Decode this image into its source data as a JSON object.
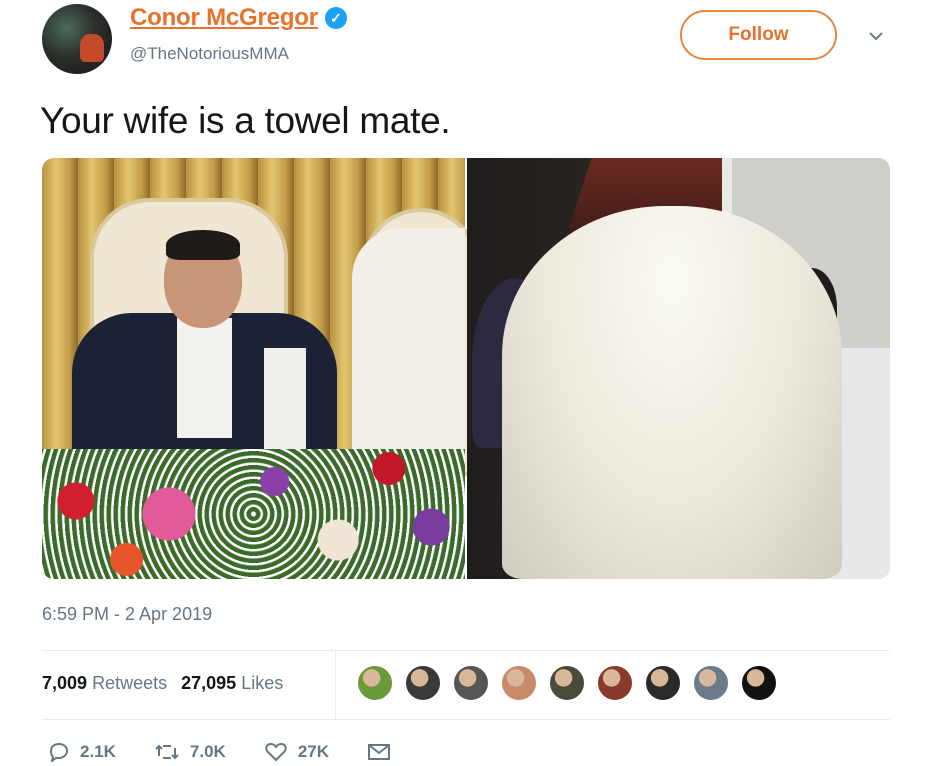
{
  "author": {
    "display_name": "Conor McGregor",
    "handle": "@TheNotoriousMMA",
    "verified": true
  },
  "follow_button": {
    "label": "Follow"
  },
  "tweet": {
    "text": "Your wife is a towel mate.",
    "timestamp": "6:59 PM - 2 Apr 2019"
  },
  "stats": {
    "retweets_count": "7,009",
    "retweets_label": "Retweets",
    "likes_count": "27,095",
    "likes_label": "Likes"
  },
  "liker_avatar_colors": [
    "#6a9a3a",
    "#3a3a3a",
    "#555555",
    "#c98a6a",
    "#4a4a3a",
    "#8a3a2a",
    "#2a2a2a",
    "#6a7a8a",
    "#111111"
  ],
  "actions": {
    "replies": "2.1K",
    "retweets": "7.0K",
    "likes": "27K"
  },
  "colors": {
    "accent": "#e8722b",
    "verified_blue": "#1da1f2",
    "muted": "#657786"
  }
}
